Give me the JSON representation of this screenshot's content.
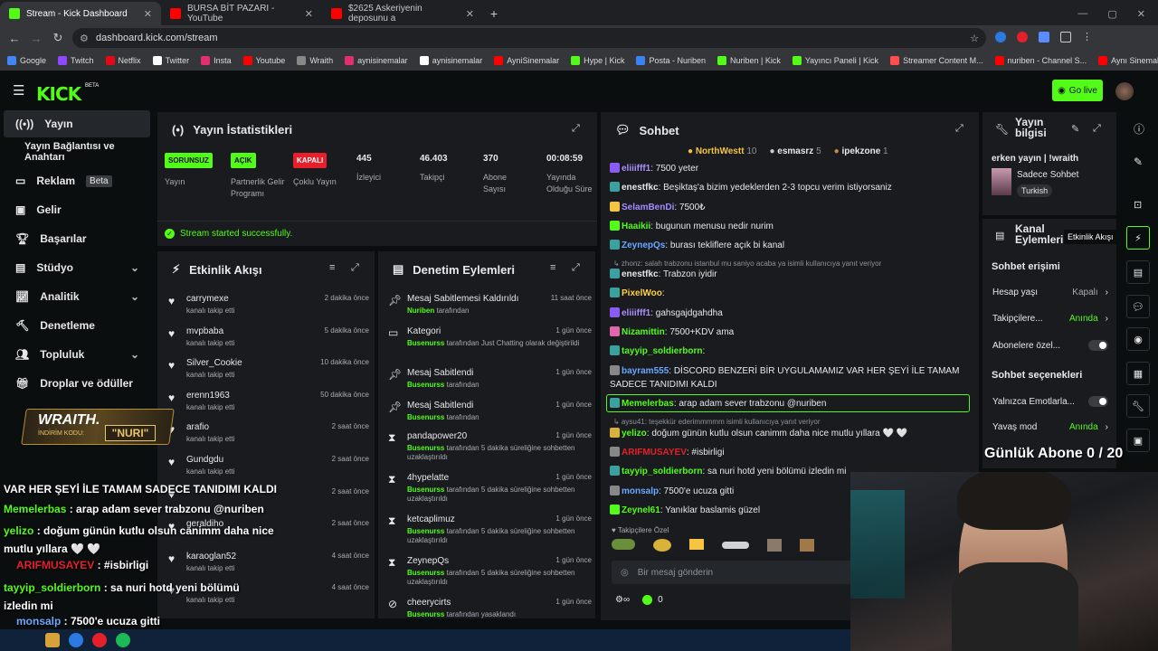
{
  "browser": {
    "tabs": [
      {
        "title": "Stream - Kick Dashboard",
        "color": "#53fc18"
      },
      {
        "title": "BURSA BİT PAZARI - YouTube",
        "color": "#ff0000"
      },
      {
        "title": "$2625 Askeriyenin deposunu a",
        "color": "#ff0000"
      }
    ],
    "url": "dashboard.kick.com/stream",
    "bookmarks": [
      "Google",
      "Twitch",
      "Netflix",
      "Twitter",
      "Insta",
      "Youtube",
      "Wraith",
      "aynisinemalar",
      "aynisinemalar",
      "AyniSinemalar",
      "Hype | Kick",
      "Posta - Nuriben",
      "Nuriben | Kick",
      "Yayıncı Paneli | Kick",
      "Streamer Content M...",
      "nuriben - Channel S...",
      "Aynı Sinemalar - Ça..."
    ]
  },
  "header": {
    "logo": "KICK",
    "beta": "BETA",
    "go_live": "Go live"
  },
  "sidebar": {
    "items": [
      "Yayın",
      "Yayın Bağlantısı ve Anahtarı",
      "Reklam",
      "Gelir",
      "Başarılar",
      "Stüdyo",
      "Analitik",
      "Denetleme",
      "Topluluk",
      "Droplar ve ödüller"
    ],
    "beta_badge": "Beta"
  },
  "stats": {
    "title": "Yayın İstatistikleri",
    "cols": [
      {
        "pill": "SORUNSUZ",
        "label": "Yayın",
        "pill_color": "#53fc18"
      },
      {
        "pill": "AÇIK",
        "label": "Partnerlik Gelir Programı",
        "pill_color": "#53fc18"
      },
      {
        "pill": "KAPALI",
        "label": "Çoklu Yayın",
        "pill_color": "#e5202b"
      },
      {
        "num": "445",
        "label": "İzleyici"
      },
      {
        "num": "46.403",
        "label": "Takipçi"
      },
      {
        "num": "370",
        "label": "Abone Sayısı"
      },
      {
        "num": "00:08:59",
        "label": "Yayında Olduğu Süre"
      }
    ],
    "success": "Stream started successfully."
  },
  "activity": {
    "title": "Etkinlik Akışı",
    "rows": [
      {
        "name": "carrymexe",
        "sub": "kanalı takip etti",
        "time": "2 dakika önce"
      },
      {
        "name": "mvpbaba",
        "sub": "kanalı takip etti",
        "time": "5 dakika önce"
      },
      {
        "name": "Silver_Cookie",
        "sub": "kanalı takip etti",
        "time": "10 dakika önce"
      },
      {
        "name": "erenn1963",
        "sub": "kanalı takip etti",
        "time": "50 dakika önce"
      },
      {
        "name": "arafio",
        "sub": "kanalı takip etti",
        "time": "2 saat önce"
      },
      {
        "name": "Gundgdu",
        "sub": "kanalı takip etti",
        "time": "2 saat önce"
      },
      {
        "name": "",
        "sub": "",
        "time": "2 saat önce"
      },
      {
        "name": "geraldiho",
        "sub": "",
        "time": "2 saat önce"
      },
      {
        "name": "karaoglan52",
        "sub": "kanalı takip etti",
        "time": "4 saat önce"
      },
      {
        "name": "",
        "sub": "kanalı takip etti",
        "time": "4 saat önce"
      }
    ]
  },
  "moderation": {
    "title": "Denetim Eylemleri",
    "rows": [
      {
        "name": "Mesaj Sabitlemesi Kaldırıldı",
        "by": "Nuriben",
        "sub": "tarafından",
        "time": "11 saat önce"
      },
      {
        "name": "Kategori",
        "by": "Busenurss",
        "sub": "tarafından Just Chatting olarak değiştirildi",
        "time": "1 gün önce"
      },
      {
        "name": "Mesaj Sabitlendi",
        "by": "Busenurss",
        "sub": "tarafından",
        "time": "1 gün önce"
      },
      {
        "name": "Mesaj Sabitlendi",
        "by": "Busenurss",
        "sub": "tarafından",
        "time": "1 gün önce"
      },
      {
        "name": "pandapower20",
        "by": "Busenurss",
        "sub": "tarafından 5 dakika süreliğine sohbetten uzaklaştırıldı",
        "time": "1 gün önce"
      },
      {
        "name": "4hypelatte",
        "by": "Busenurss",
        "sub": "tarafından 5 dakika süreliğine sohbetten uzaklaştırıldı",
        "time": "1 gün önce"
      },
      {
        "name": "ketcaplimuz",
        "by": "Busenurss",
        "sub": "tarafından 5 dakika süreliğine sohbetten uzaklaştırıldı",
        "time": "1 gün önce"
      },
      {
        "name": "ZeynepQs",
        "by": "Busenurss",
        "sub": "tarafından 5 dakika süreliğine sohbetten uzaklaştırıldı",
        "time": "1 gün önce"
      },
      {
        "name": "cheerycirts",
        "by": "Busenurss",
        "sub": "tarafından yasaklandı",
        "time": "1 gün önce"
      }
    ]
  },
  "chat": {
    "title": "Sohbet",
    "top": [
      {
        "name": "NorthWestt",
        "count": "10"
      },
      {
        "name": "esmasrz",
        "count": "5"
      },
      {
        "name": "ipekzone",
        "count": "1"
      }
    ],
    "messages": [
      {
        "user": "eliiifff1",
        "color": "#b18cff",
        "text": ": 7500 yeter"
      },
      {
        "user": "enestfkc",
        "color": "#e6e8ea",
        "text": ": Beşiktaş'a bizim yedeklerden 2-3 topcu verim istiyorsaniz"
      },
      {
        "user": "SelamBenDi",
        "color": "#a48bff",
        "text": ": 7500₺"
      },
      {
        "user": "Haaikii",
        "color": "#53fc18",
        "text": ": bugunun menusu nedir nurim"
      },
      {
        "user": "ZeynepQs",
        "color": "#6aa8ff",
        "text": ": burası tekliflere açık bi kanal"
      },
      {
        "user": "enestfkc",
        "color": "#e6e8ea",
        "text": ": Trabzon iyidir"
      },
      {
        "user": "PixelWoo",
        "color": "#ffd23f",
        "text": ":"
      },
      {
        "user": "eliiifff1",
        "color": "#b18cff",
        "text": ": gahsgajdgahdha"
      },
      {
        "user": "Nizamittin",
        "color": "#53fc18",
        "text": ": 7500+KDV ama"
      },
      {
        "user": "tayyip_soldierborn",
        "color": "#53fc18",
        "text": ":"
      },
      {
        "user": "bayram555",
        "color": "#6aa8ff",
        "text": ": DİSCORD BENZERİ BİR UYGULAMAMIZ VAR HER ŞEYİ İLE TAMAM SADECE TANIDIMI KALDI"
      },
      {
        "user": "Memelerbas",
        "color": "#53fc18",
        "text": ": arap adam sever trabzonu @nuriben"
      },
      {
        "user": "yelizo",
        "color": "#53fc18",
        "text": ": doğum günün kutlu olsun canimm daha nice mutlu yıllara 🤍 🤍"
      },
      {
        "user": "ARIFMUSAYEV",
        "color": "#e5202b",
        "text": ": #isbirligi"
      },
      {
        "user": "tayyip_soldierborn",
        "color": "#53fc18",
        "text": ": sa nuri hotd yeni bölümü izledin mi"
      },
      {
        "user": "monsalp",
        "color": "#6aa8ff",
        "text": ": 7500'e ucuza gitti"
      },
      {
        "user": "Zeynel61",
        "color": "#53fc18",
        "text": ": Yanıklar baslamis güzel"
      }
    ],
    "reply1": "↳ zhonz: salah trabzonu istanbul mu saniyo acaba ya isimli kullanıcıya yanıt veriyor",
    "reply2": "↳ aysu41: teşekkür ederimmmmm isimli kullanıcıya yanıt veriyor",
    "followers_only": "Takipçilere Özel",
    "placeholder": "Bir mesaj gönderin",
    "points": "0"
  },
  "info": {
    "title": "Yayın bilgisi",
    "stream_title": "erken yayın | !wraith",
    "category": "Sadece Sohbet",
    "language": "Turkish"
  },
  "channel": {
    "title": "Kanal Eylemleri",
    "tooltip": "Etkinlik Akışı",
    "chat_access": "Sohbet erişimi",
    "rows": [
      {
        "label": "Hesap yaşı",
        "value": "Kapalı"
      },
      {
        "label": "Takipçilere...",
        "value": "Anında"
      },
      {
        "label": "Abonelere özel...",
        "value": ""
      }
    ],
    "chat_options": "Sohbet seçenekleri",
    "rows2": [
      {
        "label": "Yalnızca Emotlarla...",
        "value": ""
      },
      {
        "label": "Yavaş mod",
        "value": "Anında"
      }
    ]
  },
  "overlay": {
    "sub_goal": "Günlük Abone 0 / 20",
    "wraith": "WRAITH.",
    "code_label": "İNDİRİM KODU:",
    "code": "NURI",
    "lines": [
      {
        "user": "",
        "text": "VAR HER ŞEYİ İLE TAMAM SADECE TANIDIMI KALDI"
      },
      {
        "user": "Memelerbas",
        "text": " : arap adam sever trabzonu @nuriben"
      },
      {
        "user": "yelizo",
        "text": " : doğum günün kutlu olsun canimm daha nice mutlu yıllara 🤍 🤍"
      },
      {
        "user": "ARIFMUSAYEV",
        "text": " : #isbirligi"
      },
      {
        "user": "tayyip_soldierborn",
        "text": " : sa nuri hotd yeni bölümü izledin mi"
      },
      {
        "user": "monsalp",
        "text": " : 7500'e ucuza gitti"
      },
      {
        "user": "Zeynel61",
        "text": " : Yanıklar baslamis güzel"
      }
    ]
  }
}
